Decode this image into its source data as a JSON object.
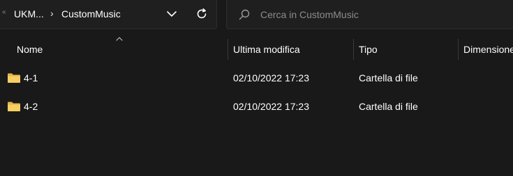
{
  "address_bar": {
    "more_glyph": "«",
    "root_crumb": "UKM...",
    "separator": "›",
    "current_crumb": "CustomMusic"
  },
  "search": {
    "placeholder": "Cerca in CustomMusic",
    "value": ""
  },
  "columns": {
    "name": "Nome",
    "modified": "Ultima modifica",
    "type": "Tipo",
    "size": "Dimensione"
  },
  "rows": [
    {
      "name": "4-1",
      "modified": "02/10/2022 17:23",
      "type": "Cartella di file",
      "size": ""
    },
    {
      "name": "4-2",
      "modified": "02/10/2022 17:23",
      "type": "Cartella di file",
      "size": ""
    }
  ],
  "icons": {
    "folder": "folder-icon",
    "search": "search-icon",
    "refresh": "refresh-icon",
    "dropdown": "chevron-down-icon",
    "sort": "sort-ascending-icon"
  },
  "colors": {
    "background": "#191919",
    "folder": "#f4c85a",
    "text": "#ffffff"
  }
}
